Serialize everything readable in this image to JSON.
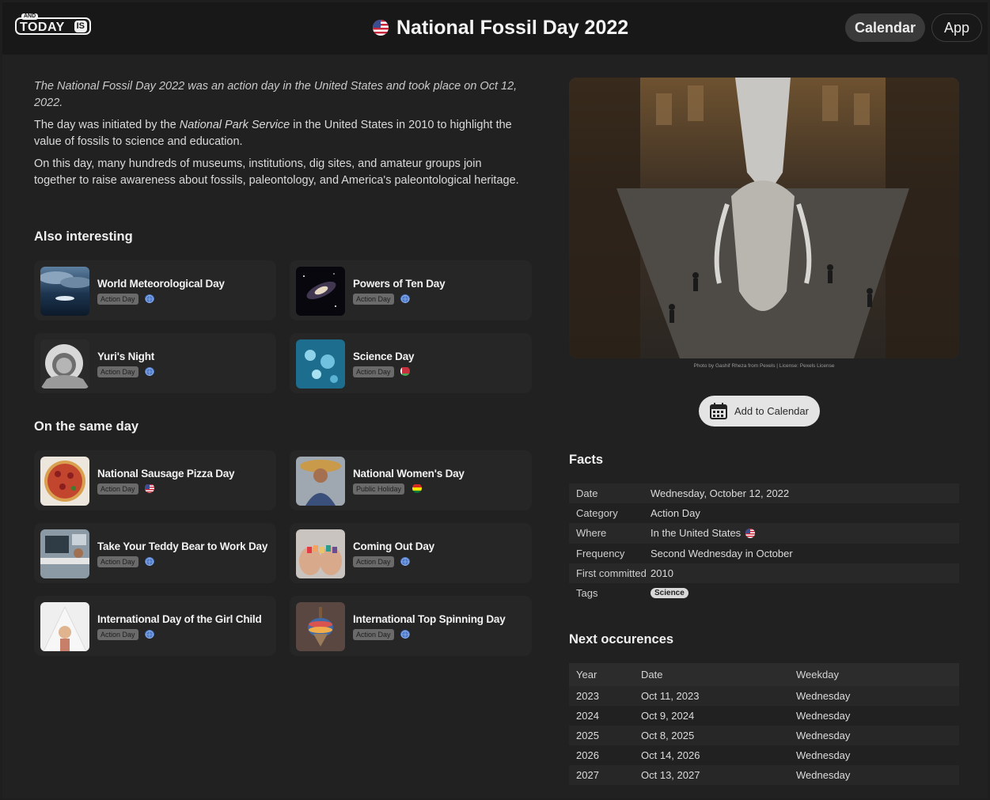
{
  "header": {
    "logo": {
      "and": "AND",
      "today": "TODAY",
      "is": "IS"
    },
    "title": "National Fossil Day 2022",
    "nav": {
      "calendar": "Calendar",
      "app": "App"
    }
  },
  "intro": {
    "lead": "The National Fossil Day 2022 was an action day in the United States and took place on Oct 12, 2022.",
    "p2_before": "The day was initiated by the ",
    "p2_em": "National Park Service",
    "p2_after": " in the United States in 2010 to highlight the value of fossils to science and education.",
    "p3": "On this day, many hundreds of museums, institutions, dig sites, and amateur groups join together to raise awareness about fossils, paleontology, and America's paleontological heritage."
  },
  "also_interesting": {
    "heading": "Also interesting",
    "items": [
      {
        "name": "World Meteorological Day",
        "tag": "Action Day",
        "flag": "world-globe-icon"
      },
      {
        "name": "Powers of Ten Day",
        "tag": "Action Day",
        "flag": "world-globe-icon"
      },
      {
        "name": "Yuri's Night",
        "tag": "Action Day",
        "flag": "world-globe-icon"
      },
      {
        "name": "Science Day",
        "tag": "Action Day",
        "flag": "belarus-flag-icon"
      }
    ]
  },
  "same_day": {
    "heading": "On the same day",
    "items": [
      {
        "name": "National Sausage Pizza Day",
        "tag": "Action Day",
        "flag": "us-flag-icon"
      },
      {
        "name": "National Women's Day",
        "tag": "Public Holiday",
        "flag": "bolivia-flag-icon"
      },
      {
        "name": "Take Your Teddy Bear to Work Day",
        "tag": "Action Day",
        "flag": "world-globe-icon"
      },
      {
        "name": "Coming Out Day",
        "tag": "Action Day",
        "flag": "world-globe-icon"
      },
      {
        "name": "International Day of the Girl Child",
        "tag": "Action Day",
        "flag": "world-globe-icon"
      },
      {
        "name": "International Top Spinning Day",
        "tag": "Action Day",
        "flag": "world-globe-icon"
      }
    ]
  },
  "photo": {
    "credit": "Photo by Gashif Rheza from Pexels | License: Pexels License"
  },
  "add_to_calendar": "Add to Calendar",
  "facts": {
    "heading": "Facts",
    "rows": [
      {
        "key": "Date",
        "value": "Wednesday, October 12, 2022"
      },
      {
        "key": "Category",
        "value": "Action Day"
      },
      {
        "key": "Where",
        "value": "In the United States"
      },
      {
        "key": "Frequency",
        "value": "Second Wednesday in October"
      },
      {
        "key": "First committed",
        "value": "2010"
      },
      {
        "key": "Tags",
        "value": "Science"
      }
    ]
  },
  "occurrences": {
    "heading": "Next occurences",
    "columns": [
      "Year",
      "Date",
      "Weekday"
    ],
    "rows": [
      {
        "year": "2023",
        "date": "Oct 11, 2023",
        "weekday": "Wednesday"
      },
      {
        "year": "2024",
        "date": "Oct 9, 2024",
        "weekday": "Wednesday"
      },
      {
        "year": "2025",
        "date": "Oct 8, 2025",
        "weekday": "Wednesday"
      },
      {
        "year": "2026",
        "date": "Oct 14, 2026",
        "weekday": "Wednesday"
      },
      {
        "year": "2027",
        "date": "Oct 13, 2027",
        "weekday": "Wednesday"
      }
    ]
  },
  "colors": {
    "background": "#212121",
    "header": "#181818",
    "card": "#262626",
    "tag": "#6a6a6a"
  }
}
